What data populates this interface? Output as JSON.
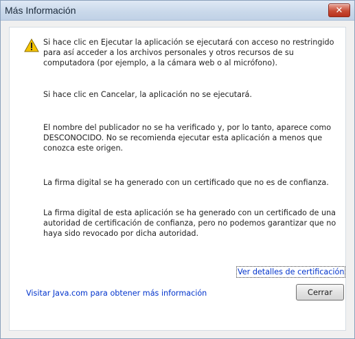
{
  "window": {
    "title": "Más Información",
    "close_glyph": "✕"
  },
  "icons": {
    "warning": "warning-icon",
    "close": "close-icon"
  },
  "colors": {
    "link": "#0033cc",
    "warning_fill": "#f5c400",
    "close_button": "#c74b35"
  },
  "message": {
    "paragraphs": [
      "Si hace clic en Ejecutar la aplicación se ejecutará con acceso no restringido\npara así acceder a los archivos personales y otros recursos de su\ncomputadora (por ejemplo, a la cámara web o al micrófono).",
      "Si hace clic en Cancelar, la aplicación no se ejecutará.",
      "El nombre del publicador no se ha verificado y, por lo tanto, aparece como\nDESCONOCIDO. No se recomienda ejecutar esta aplicación a menos que\nconozca este origen.",
      "La firma digital se ha generado con un certificado que no es de confianza.",
      "La firma digital de esta aplicación se ha generado con un certificado de una\nautoridad de certificación de confianza, pero no podemos garantizar que no\nhaya sido revocado por dicha autoridad."
    ]
  },
  "links": {
    "certificate_details": "Ver detalles de certificación",
    "java_info": "Visitar Java.com para obtener más información"
  },
  "buttons": {
    "close_label": "Cerrar"
  }
}
